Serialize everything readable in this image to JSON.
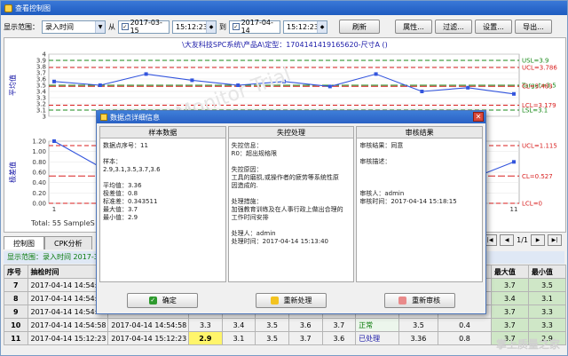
{
  "window": {
    "title": "查看控制图"
  },
  "toolbar": {
    "range_label": "显示范围：",
    "range_value": "录入时间",
    "from_label": "从",
    "from_date": "2017-03-15",
    "from_time": "15:12:23",
    "to_label": "到",
    "to_date": "2017-04-14",
    "to_time": "15:12:23",
    "refresh": "刷新",
    "props": "属性...",
    "filter": "过滤...",
    "settings": "设置...",
    "export": "导出..."
  },
  "chart": {
    "title": "\\大友科技SPC系统\\产品A\\定型：17041414191656​20-尺寸A    ()",
    "total": "Total: 55   SampleS",
    "watermark": "SPC Monitor Trial"
  },
  "chart_data": [
    {
      "type": "line",
      "ylabel": "平均值",
      "yticks": [
        "4",
        "3.9",
        "3.8",
        "3.7",
        "3.6",
        "3.5",
        "3.4",
        "3.3",
        "3.2",
        "3.1",
        "3"
      ],
      "ylim": [
        3,
        4
      ],
      "x": [
        1,
        2,
        3,
        4,
        5,
        6,
        7,
        8,
        9,
        10,
        11
      ],
      "values": [
        3.56,
        3.5,
        3.68,
        3.58,
        3.5,
        3.56,
        3.48,
        3.68,
        3.4,
        3.46,
        3.36
      ],
      "limits": [
        {
          "name": "USL",
          "label": "USL=3.9",
          "value": 3.9,
          "color": "#1a8a1a"
        },
        {
          "name": "UCL",
          "label": "UCL=3.786",
          "value": 3.786,
          "color": "#d81e1e"
        },
        {
          "name": "Target",
          "label": "Target=3.5",
          "value": 3.5,
          "color": "#1a8a1a"
        },
        {
          "name": "CL",
          "label": "CL=3.483",
          "value": 3.483,
          "color": "#d81e1e"
        },
        {
          "name": "LCL",
          "label": "LCL=3.179",
          "value": 3.179,
          "color": "#d81e1e"
        },
        {
          "name": "LSL",
          "label": "LSL=3.1",
          "value": 3.1,
          "color": "#1a8a1a"
        }
      ]
    },
    {
      "type": "line",
      "ylabel": "极差值",
      "yticks": [
        "1.20",
        "1.00",
        "0.80",
        "0.60",
        "0.40",
        "0.20",
        "0.00"
      ],
      "ylim": [
        0,
        1.2
      ],
      "x": [
        1,
        2,
        3,
        4,
        5,
        6,
        7,
        8,
        9,
        10,
        11
      ],
      "values": [
        1.2,
        0.7,
        0.5,
        0.6,
        0.4,
        0.55,
        0.3,
        0.4,
        0.5,
        0.45,
        0.8
      ],
      "xticks": [
        "1",
        "11"
      ],
      "limits": [
        {
          "name": "UCL",
          "label": "UCL=1.115",
          "value": 1.115,
          "color": "#d81e1e"
        },
        {
          "name": "CL",
          "label": "CL=0.527",
          "value": 0.527,
          "color": "#d81e1e"
        },
        {
          "name": "LCL",
          "label": "LCL=0",
          "value": 0,
          "color": "#d81e1e"
        }
      ]
    }
  ],
  "tabs": [
    {
      "label": "控制图"
    },
    {
      "label": "CPK分析"
    }
  ],
  "pager": {
    "text": "1/1"
  },
  "filterbar": {
    "text": "显示范围：录入时间  2017-3-"
  },
  "table": {
    "headers": [
      "序号",
      "抽检时间",
      "",
      "",
      "",
      "",
      "",
      "",
      "",
      "",
      "最大值",
      "最小值"
    ],
    "rows": [
      {
        "n": "7",
        "time": "2017-04-14 14:54:07",
        "time2": "",
        "v1": "",
        "v2": "",
        "v3": "",
        "v4": "",
        "v5": "",
        "status": "",
        "avg": "",
        "sd": "",
        "max": "3.7",
        "min": "3.5"
      },
      {
        "n": "8",
        "time": "2017-04-14 14:54:17",
        "time2": "",
        "v1": "",
        "v2": "",
        "v3": "",
        "v4": "",
        "v5": "",
        "status": "",
        "avg": "",
        "sd": "",
        "max": "3.4",
        "min": "3.1"
      },
      {
        "n": "9",
        "time": "2017-04-14 14:54:43",
        "time2": "",
        "v1": "",
        "v2": "",
        "v3": "",
        "v4": "",
        "v5": "",
        "status": "",
        "avg": "",
        "sd": "",
        "max": "3.7",
        "min": "3.3"
      },
      {
        "n": "10",
        "time": "2017-04-14 14:54:58",
        "time2": "2017-04-14 14:54:58",
        "v1": "3.3",
        "v2": "3.4",
        "v3": "3.5",
        "v4": "3.6",
        "v5": "3.7",
        "status": "正常",
        "avg": "3.5",
        "sd": "0.4",
        "max": "3.7",
        "min": "3.3"
      },
      {
        "n": "11",
        "time": "2017-04-14 15:12:23",
        "time2": "2017-04-14 15:12:23",
        "v1": "2.9",
        "v2": "3.1",
        "v3": "3.5",
        "v4": "3.7",
        "v5": "3.6",
        "status": "已处理",
        "avg": "3.36",
        "sd": "0.8",
        "max": "3.7",
        "min": "2.9"
      }
    ]
  },
  "watermark2": "掌上质量之家",
  "dialog": {
    "title": "数据点详细信息",
    "col1_head": "样本数据",
    "col2_head": "失控处理",
    "col3_head": "审核结果",
    "col1": [
      "数据点序号：11",
      "",
      "样本：",
      "2.9,3.1,3.5,3.7,3.6",
      "",
      "平均值：3.36",
      "极差值：0.8",
      "标准差：0.343511",
      "最大值：3.7",
      "最小值：2.9"
    ],
    "col2": [
      "失控信息：",
      " R0：超出规格限",
      "",
      "失控原因：",
      "工具的磨损,或操作者的疲劳等系统性原",
      "因造成的.",
      "",
      "处理措施：",
      "加强教育训练及在人事行政上做出合理的",
      "工作时间安排",
      "",
      "处理人：admin",
      "处理时间：2017-04-14 15:13:40"
    ],
    "col3": [
      "审核结果：同意",
      "",
      "审核描述：",
      "",
      "",
      "",
      "审核人：admin",
      "审核时间：2017-04-14 15:18:15"
    ],
    "ok": "确定",
    "reprocess": "重新处理",
    "reaudit": "重新审核"
  }
}
